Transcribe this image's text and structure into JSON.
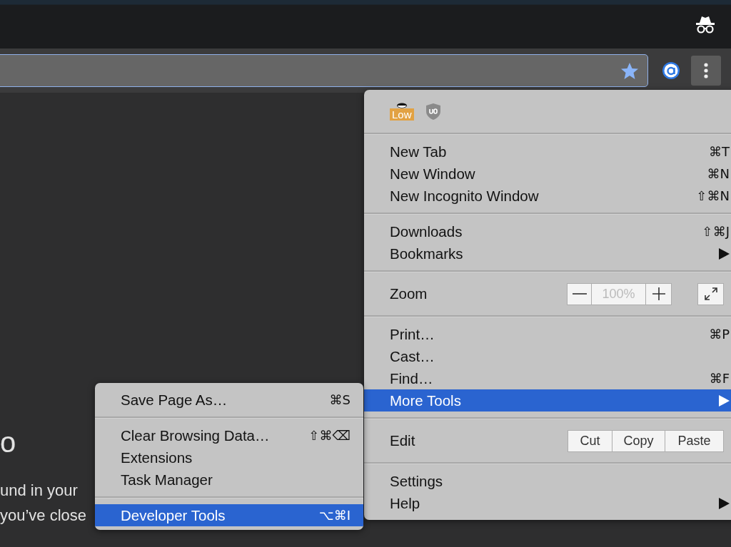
{
  "page": {
    "heading": "o",
    "lines": [
      "und in your",
      "you’ve close"
    ]
  },
  "menu": {
    "extensions": [
      {
        "kind": "hat",
        "badge": "Low"
      },
      {
        "kind": "shield"
      }
    ],
    "groups": [
      [
        {
          "kind": "item",
          "label": "New Tab",
          "shortcut": "⌘T",
          "submenu": false,
          "selected": false
        },
        {
          "kind": "item",
          "label": "New Window",
          "shortcut": "⌘N",
          "submenu": false,
          "selected": false
        },
        {
          "kind": "item",
          "label": "New Incognito Window",
          "shortcut": "⇧⌘N",
          "submenu": false,
          "selected": false
        }
      ],
      [
        {
          "kind": "item",
          "label": "Downloads",
          "shortcut": "⇧⌘J",
          "submenu": false,
          "selected": false
        },
        {
          "kind": "item",
          "label": "Bookmarks",
          "submenu": true,
          "selected": false
        }
      ],
      [
        {
          "kind": "zoom",
          "label": "Zoom",
          "value": "100%"
        }
      ],
      [
        {
          "kind": "item",
          "label": "Print…",
          "shortcut": "⌘P",
          "submenu": false,
          "selected": false
        },
        {
          "kind": "item",
          "label": "Cast…",
          "submenu": false,
          "selected": false
        },
        {
          "kind": "item",
          "label": "Find…",
          "shortcut": "⌘F",
          "submenu": false,
          "selected": false
        },
        {
          "kind": "item",
          "label": "More Tools",
          "submenu": true,
          "selected": true
        }
      ],
      [
        {
          "kind": "edit",
          "label": "Edit",
          "buttons": [
            "Cut",
            "Copy",
            "Paste"
          ]
        }
      ],
      [
        {
          "kind": "item",
          "label": "Settings",
          "submenu": false,
          "selected": false
        },
        {
          "kind": "item",
          "label": "Help",
          "submenu": true,
          "selected": false
        }
      ]
    ]
  },
  "submenu": {
    "groups": [
      [
        {
          "kind": "item",
          "label": "Save Page As…",
          "shortcut": "⌘S",
          "submenu": false,
          "selected": false
        }
      ],
      [
        {
          "kind": "item",
          "label": "Clear Browsing Data…",
          "shortcut": "⇧⌘⌫",
          "submenu": false,
          "selected": false
        },
        {
          "kind": "item",
          "label": "Extensions",
          "submenu": false,
          "selected": false
        },
        {
          "kind": "item",
          "label": "Task Manager",
          "submenu": false,
          "selected": false
        }
      ],
      [
        {
          "kind": "item",
          "label": "Developer Tools",
          "shortcut": "⌥⌘I",
          "submenu": false,
          "selected": true
        }
      ]
    ]
  }
}
